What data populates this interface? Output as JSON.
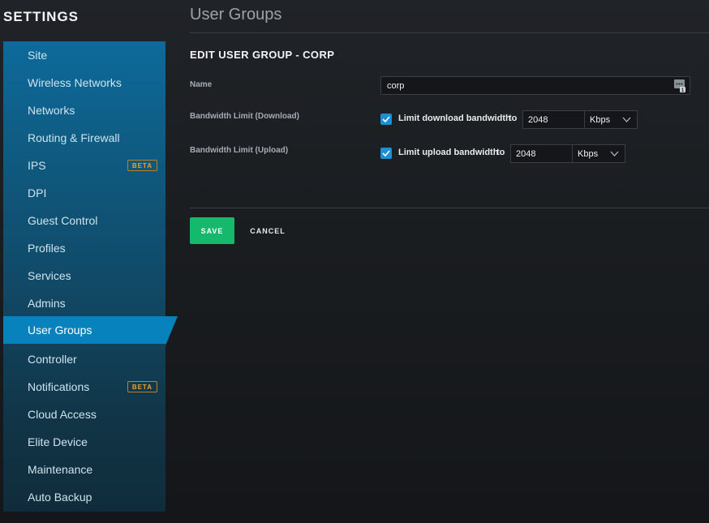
{
  "sidebar": {
    "heading": "SETTINGS",
    "items": [
      {
        "label": "Site"
      },
      {
        "label": "Wireless Networks"
      },
      {
        "label": "Networks"
      },
      {
        "label": "Routing & Firewall"
      },
      {
        "label": "IPS",
        "badge": "BETA"
      },
      {
        "label": "DPI"
      },
      {
        "label": "Guest Control"
      },
      {
        "label": "Profiles"
      },
      {
        "label": "Services"
      },
      {
        "label": "Admins"
      },
      {
        "label": "User Groups",
        "active": true
      },
      {
        "label": "Controller"
      },
      {
        "label": "Notifications",
        "badge": "BETA"
      },
      {
        "label": "Cloud Access"
      },
      {
        "label": "Elite Device"
      },
      {
        "label": "Maintenance"
      },
      {
        "label": "Auto Backup"
      }
    ]
  },
  "main": {
    "page_title": "User Groups",
    "section_title": "EDIT USER GROUP - CORP",
    "name": {
      "label": "Name",
      "value": "corp",
      "icon": "password-manager-icon"
    },
    "download": {
      "label": "Bandwidth Limit (Download)",
      "checkbox_label": "Limit download bandwidth",
      "checked": true,
      "to": "to",
      "value": "2048",
      "unit": "Kbps"
    },
    "upload": {
      "label": "Bandwidth Limit (Upload)",
      "checkbox_label": "Limit upload bandwidth",
      "checked": true,
      "to": "to",
      "value": "2048",
      "unit": "Kbps"
    },
    "save_label": "SAVE",
    "cancel_label": "CANCEL"
  },
  "colors": {
    "accent": "#0882bd",
    "save": "#16b86c",
    "badge": "#f0a02a",
    "checkbox": "#1c8fd6"
  }
}
